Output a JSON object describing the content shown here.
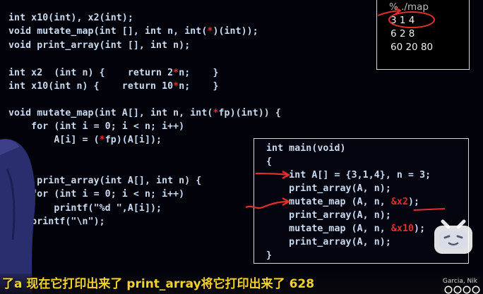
{
  "code": {
    "decl1": "int x10(int), x2(int);",
    "decl2_a": "void mutate_map(int [], int n, int(",
    "decl2_star": "*",
    "decl2_b": ")(int));",
    "decl3": "void print_array(int [], int n);",
    "x2_def_a": "int x2  (int n) {    return 2",
    "x2_def_star": "*",
    "x2_def_b": "n;    }",
    "x10_def_a": "int x10(int n) {    return 10",
    "x10_def_star": "*",
    "x10_def_b": "n;    }",
    "mm_sig_a": "void mutate_map(int A[], int n, int(",
    "mm_sig_star": "*",
    "mm_sig_b": "fp)(int)) {",
    "mm_for": "    for (int i = 0; i < n; i++)",
    "mm_body_a": "        A[i] = (",
    "mm_body_star": "*",
    "mm_body_b": "fp)(A[i]);",
    "pa_sig": "  id print_array(int A[], int n) {",
    "pa_for": "    for (int i = 0; i < n; i++)",
    "pa_printf": "        printf(\"%d \",A[i]);",
    "pa_newline": "    printf(\"\\n\");"
  },
  "main_box": {
    "l1": "int main(void)",
    "l2": "{",
    "l3": "    int A[] = {3,1,4}, n = 3;",
    "l4": "    print_array(A, n);",
    "l5_a": "    mutate_map (A, n, ",
    "l5_red": "&x2",
    "l5_b": ");",
    "l6": "    print_array(A, n);",
    "l7_a": "    mutate_map (A, n, ",
    "l7_red": "&x10",
    "l7_b": ");",
    "l8": "    print_array(A, n);",
    "l9": "}"
  },
  "terminal": {
    "prompt": "% ./map",
    "out1": "3 1 4",
    "out2": "6 2 8",
    "out3": "60 20 80"
  },
  "subtitle": "了a 现在它打印出来了 print_array将它打印出来了 628",
  "credit": "Garcia, Nik",
  "colors": {
    "background": "#02020a",
    "code_text": "#c9dcf2",
    "keyword": "#7fa8ea",
    "accent_red": "#e0302c",
    "subtitle": "#f4d22a",
    "player_logo": "#ffffff"
  },
  "icons": {
    "player_logo": "tv-mascot-icon",
    "license": "creative-commons-icon"
  }
}
